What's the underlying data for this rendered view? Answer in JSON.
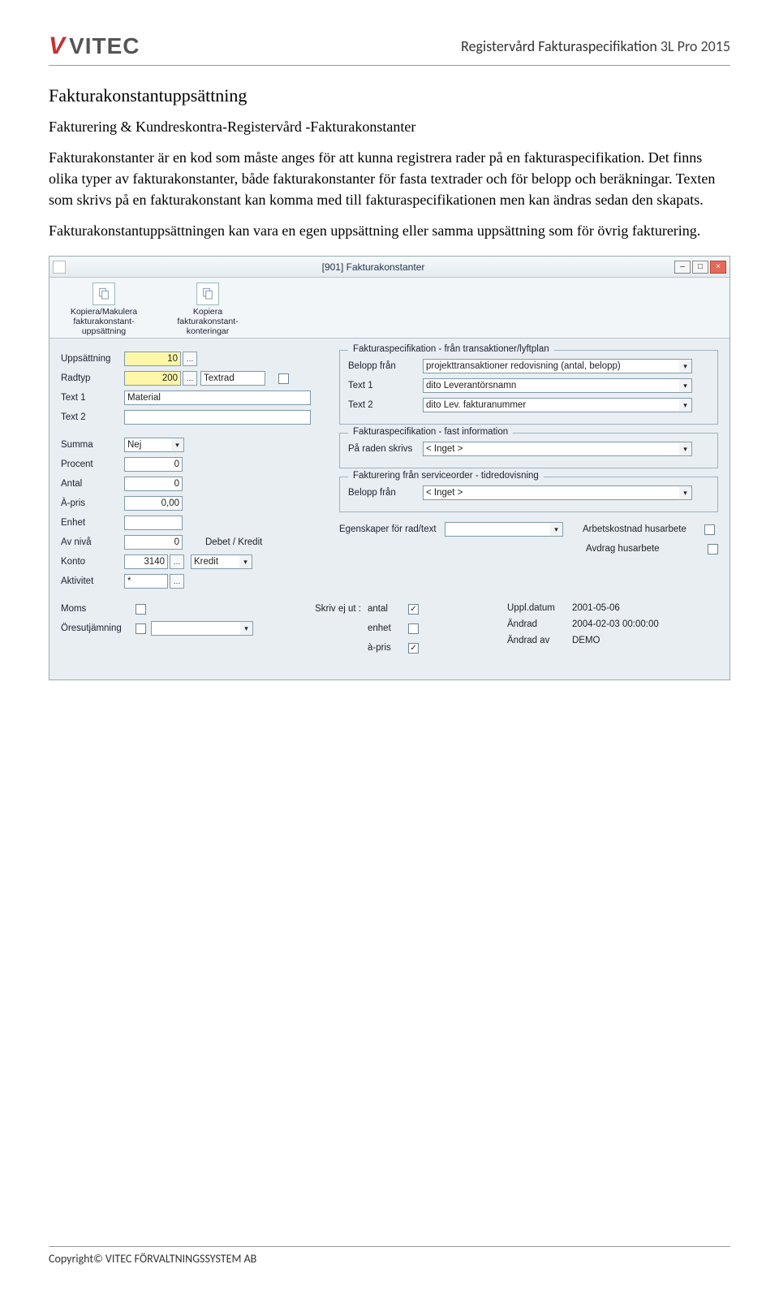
{
  "header": {
    "logo_text": "VITEC",
    "right_text": "Registervård Fakturaspecifikation",
    "right_suffix": "3L Pro 2015"
  },
  "doc": {
    "section_title": "Fakturakonstantuppsättning",
    "subtitle": "Fakturering & Kundreskontra-Registervård -Fakturakonstanter",
    "para1": "Fakturakonstanter är en kod som måste anges för att kunna registrera rader på en fakturaspecifikation. Det finns olika typer av fakturakonstanter, både fakturakonstanter för fasta textrader och för belopp och beräkningar. Texten som skrivs på en fakturakonstant kan komma med till fakturaspecifikationen men kan ändras sedan den skapats.",
    "para2": "Fakturakonstantuppsättningen kan vara en egen uppsättning eller samma uppsättning som för övrig fakturering."
  },
  "window": {
    "title": "[901]  Fakturakonstanter",
    "ribbon": {
      "item1_line1": "Kopiera/Makulera",
      "item1_line2": "fakturakonstant-",
      "item1_line3": "uppsättning",
      "item2_line1": "Kopiera",
      "item2_line2": "fakturakonstant-",
      "item2_line3": "konteringar"
    },
    "labels": {
      "uppsattning": "Uppsättning",
      "radtyp": "Radtyp",
      "text1": "Text 1",
      "text2": "Text 2",
      "summa": "Summa",
      "procent": "Procent",
      "antal": "Antal",
      "apris": "À-pris",
      "enhet": "Enhet",
      "avniva": "Av nivå",
      "konto": "Konto",
      "aktivitet": "Aktivitet",
      "debet_kredit": "Debet / Kredit",
      "moms": "Moms",
      "oresutjamning": "Öresutjämning",
      "skriv_ej_ut": "Skriv ej ut :",
      "skriv_antal": "antal",
      "skriv_enhet": "enhet",
      "skriv_apris": "à-pris",
      "uppl_datum": "Uppl.datum",
      "andrad": "Ändrad",
      "andrad_av": "Ändrad av",
      "egenskaper": "Egenskaper för rad/text",
      "arbetskostnad": "Arbetskostnad husarbete",
      "avdrag": "Avdrag husarbete"
    },
    "groups": {
      "g1": "Fakturaspecifikation - från transaktioner/lyftplan",
      "g1_belopp": "Belopp från",
      "g1_text1": "Text 1",
      "g1_text2": "Text 2",
      "g2": "Fakturaspecifikation - fast information",
      "g2_pa_raden": "På raden skrivs",
      "g3": "Fakturering från serviceorder - tidredovisning",
      "g3_belopp": "Belopp från"
    },
    "values": {
      "uppsattning": "10",
      "radtyp": "200",
      "radtyp_text": "Textrad",
      "text1": "Material",
      "text2": "",
      "summa": "Nej",
      "procent": "0",
      "antal": "0",
      "apris": "0,00",
      "enhet": "",
      "avniva": "0",
      "konto": "3140",
      "konto_dc": "Kredit",
      "aktivitet": "*",
      "g1_belopp": "projekttransaktioner redovisning (antal, belopp)",
      "g1_text1": "dito Leverantörsnamn",
      "g1_text2": "dito Lev. fakturanummer",
      "g2_pa_raden": "< Inget >",
      "g3_belopp": "< Inget >",
      "egenskaper": "",
      "uppl_datum": "2001-05-06",
      "andrad": "2004-02-03 00:00:00",
      "andrad_av": "DEMO",
      "chk_moms": "",
      "chk_ores": "",
      "chk_antal": "✓",
      "chk_enhet": "",
      "chk_apris": "✓",
      "chk_arbetskostnad": "",
      "chk_avdrag": ""
    }
  },
  "footer": {
    "text_prefix": "Copyright© V",
    "text_sc": "ITEC FÖRVALTNINGSSYSTEM AB"
  }
}
